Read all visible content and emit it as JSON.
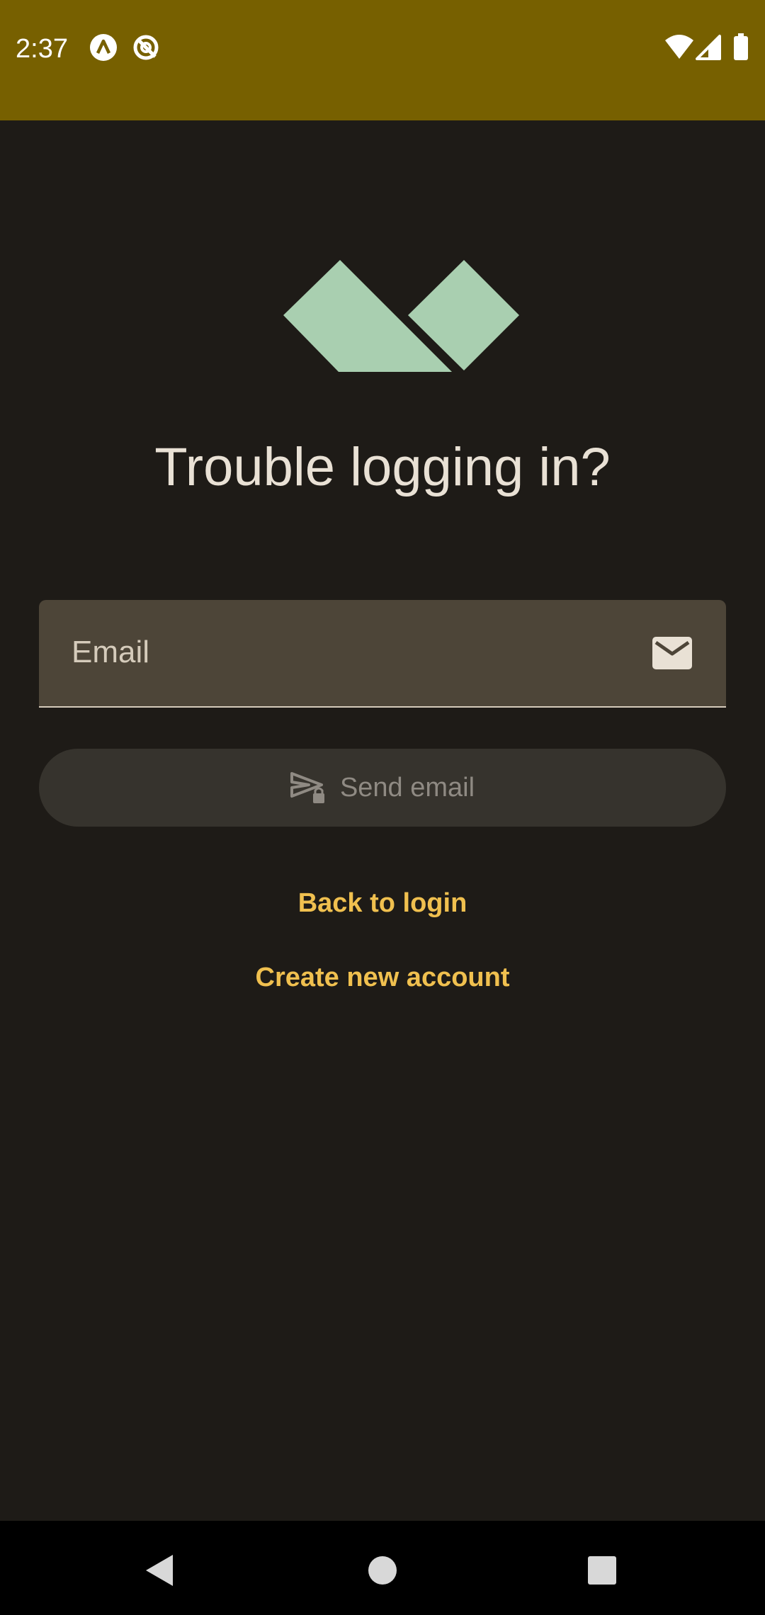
{
  "status_bar": {
    "time": "2:37",
    "left_icons": [
      "app-notification-icon",
      "sync-off-icon"
    ],
    "right_icons": [
      "wifi-icon",
      "cell-signal-icon",
      "battery-icon"
    ],
    "background_color": "#776000"
  },
  "logo": {
    "icon": "app-logo-icon",
    "color": "#a9cfb0"
  },
  "page": {
    "title": "Trouble logging in?"
  },
  "form": {
    "email_placeholder": "Email",
    "email_value": "",
    "email_icon": "mail-icon",
    "send_button_label": "Send email",
    "send_button_icon": "send-locked-icon",
    "send_button_enabled": false
  },
  "links": {
    "back_to_login": "Back to login",
    "create_account": "Create new account",
    "color": "#f0c04f"
  },
  "nav_bar": {
    "buttons": [
      "back-icon",
      "home-icon",
      "recents-icon"
    ]
  }
}
